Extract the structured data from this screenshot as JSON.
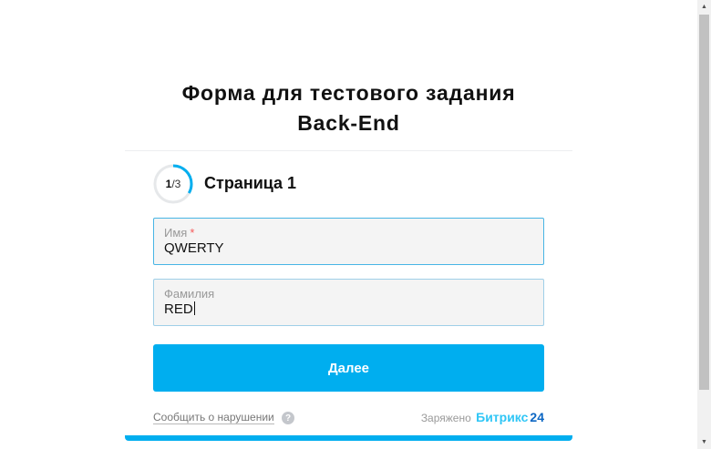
{
  "form": {
    "title_line1": "Форма для тестового задания",
    "title_line2": "Back-End"
  },
  "progress": {
    "current": "1",
    "total": "/3",
    "fraction": 0.3333,
    "page_title": "Страница 1"
  },
  "fields": {
    "name": {
      "label": "Имя",
      "required_mark": "*",
      "value": "QWERTY"
    },
    "surname": {
      "label": "Фамилия",
      "value": "RED"
    }
  },
  "actions": {
    "next_label": "Далее"
  },
  "footer": {
    "report_link": "Сообщить о нарушении",
    "help_icon_glyph": "?",
    "powered_by": "Заряжено",
    "brand_name": "Битрикс",
    "brand_number": "24"
  },
  "colors": {
    "accent": "#00aeef",
    "field_border": "#48b5e5",
    "required": "#f65a5a",
    "brand_blue": "#2fc6f6",
    "brand_dark": "#0b66c3"
  },
  "icons": {
    "scroll_up": "scroll-up-arrow-icon",
    "scroll_down": "scroll-down-arrow-icon",
    "help": "question-mark-icon"
  }
}
